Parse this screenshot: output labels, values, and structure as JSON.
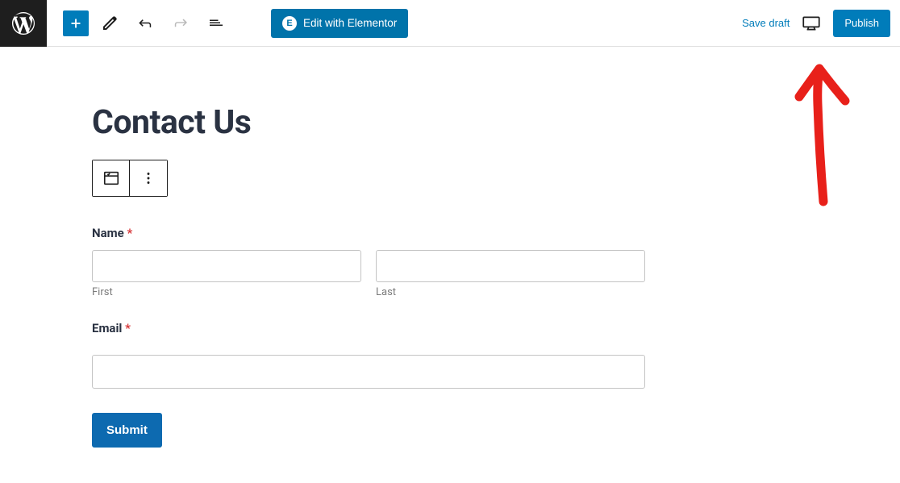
{
  "toolbar": {
    "elementor_label": "Edit with Elementor",
    "save_draft_label": "Save draft",
    "publish_label": "Publish"
  },
  "page": {
    "title": "Contact Us"
  },
  "form": {
    "name": {
      "label": "Name",
      "required_mark": "*",
      "first_sublabel": "First",
      "last_sublabel": "Last"
    },
    "email": {
      "label": "Email",
      "required_mark": "*"
    },
    "submit_label": "Submit"
  },
  "colors": {
    "primary": "#007cba",
    "required": "#d63638",
    "title": "#2a3242"
  }
}
